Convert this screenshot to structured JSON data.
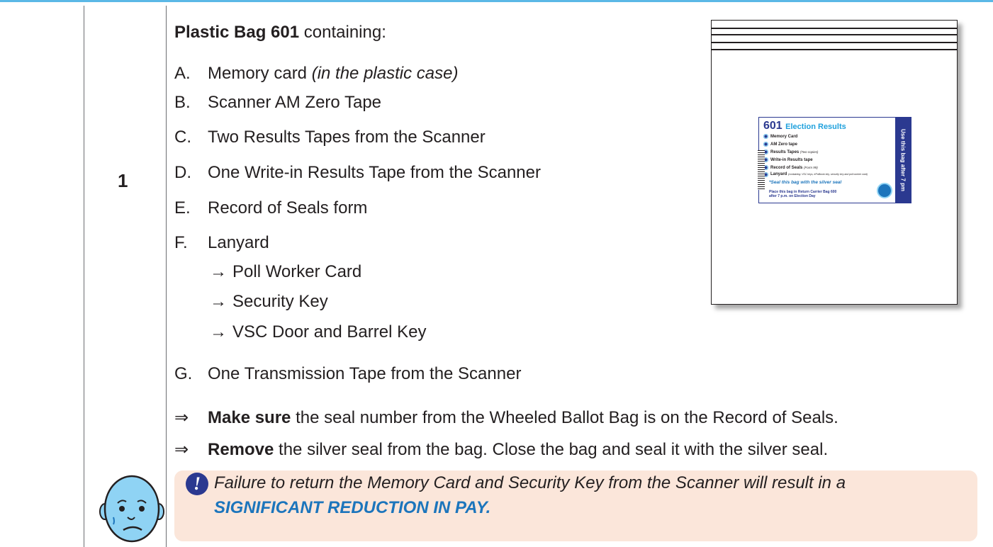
{
  "step": {
    "number": "1"
  },
  "bag": {
    "title_bold": "Plastic Bag 601",
    "title_rest": " containing:",
    "items": [
      {
        "letter": "A.",
        "text": "Memory card ",
        "note": "(in the plastic case)"
      },
      {
        "letter": "B.",
        "text": "Scanner AM Zero Tape"
      },
      {
        "letter": "C.",
        "text": "Two Results Tapes from the Scanner"
      },
      {
        "letter": "D.",
        "text": "One Write-in Results Tape from the Scanner"
      },
      {
        "letter": "E.",
        "text": "Record of Seals form"
      },
      {
        "letter": "F.",
        "text": "Lanyard"
      },
      {
        "letter": "G.",
        "text": "One Transmission Tape from the Scanner"
      }
    ],
    "lanyard_items": [
      "Poll Worker Card",
      "Security Key",
      "VSC Door and Barrel Key"
    ],
    "arrow_glyph": "→"
  },
  "instructions": [
    {
      "symbol": "⇒",
      "bold": "Make sure",
      "text": " the seal number from the Wheeled Ballot Bag is on the Record of Seals."
    },
    {
      "symbol": "⇒",
      "bold": "Remove",
      "text": " the silver seal from the bag.  Close the bag and seal it with the silver seal."
    }
  ],
  "warning": {
    "text": "Failure to return the Memory Card and Security Key from the Scanner will result in a",
    "emphasis": "SIGNIFICANT REDUCTION IN PAY.",
    "icon": "exclamation-icon",
    "icon_glyph": "!"
  },
  "bag_label": {
    "number": "601",
    "title": "Election Results",
    "items": [
      {
        "text": "Memory Card",
        "note": ""
      },
      {
        "text": "AM Zero tape",
        "note": ""
      },
      {
        "text": "Results Tapes",
        "note": "(Two copies)"
      },
      {
        "text": "Write-in Results tape",
        "note": ""
      },
      {
        "text": "Record of Seals",
        "note": "(Form 99)"
      },
      {
        "text": "Lanyard",
        "note": "(containing: VSC keys, ePollbook key, security key and poll worker card)"
      }
    ],
    "seal_note": "*Seal this bag with the silver seal",
    "place_line1": "Place this bag in Return Carrier Bag 600",
    "place_line2": "after 7 p.m. on Election Day",
    "side_text": "Use this bag after 7 pm"
  },
  "colors": {
    "accent_blue": "#1c75bc",
    "navy": "#2b3990",
    "warning_bg": "#fbe6da",
    "rule_blue": "#5bb8e6"
  }
}
